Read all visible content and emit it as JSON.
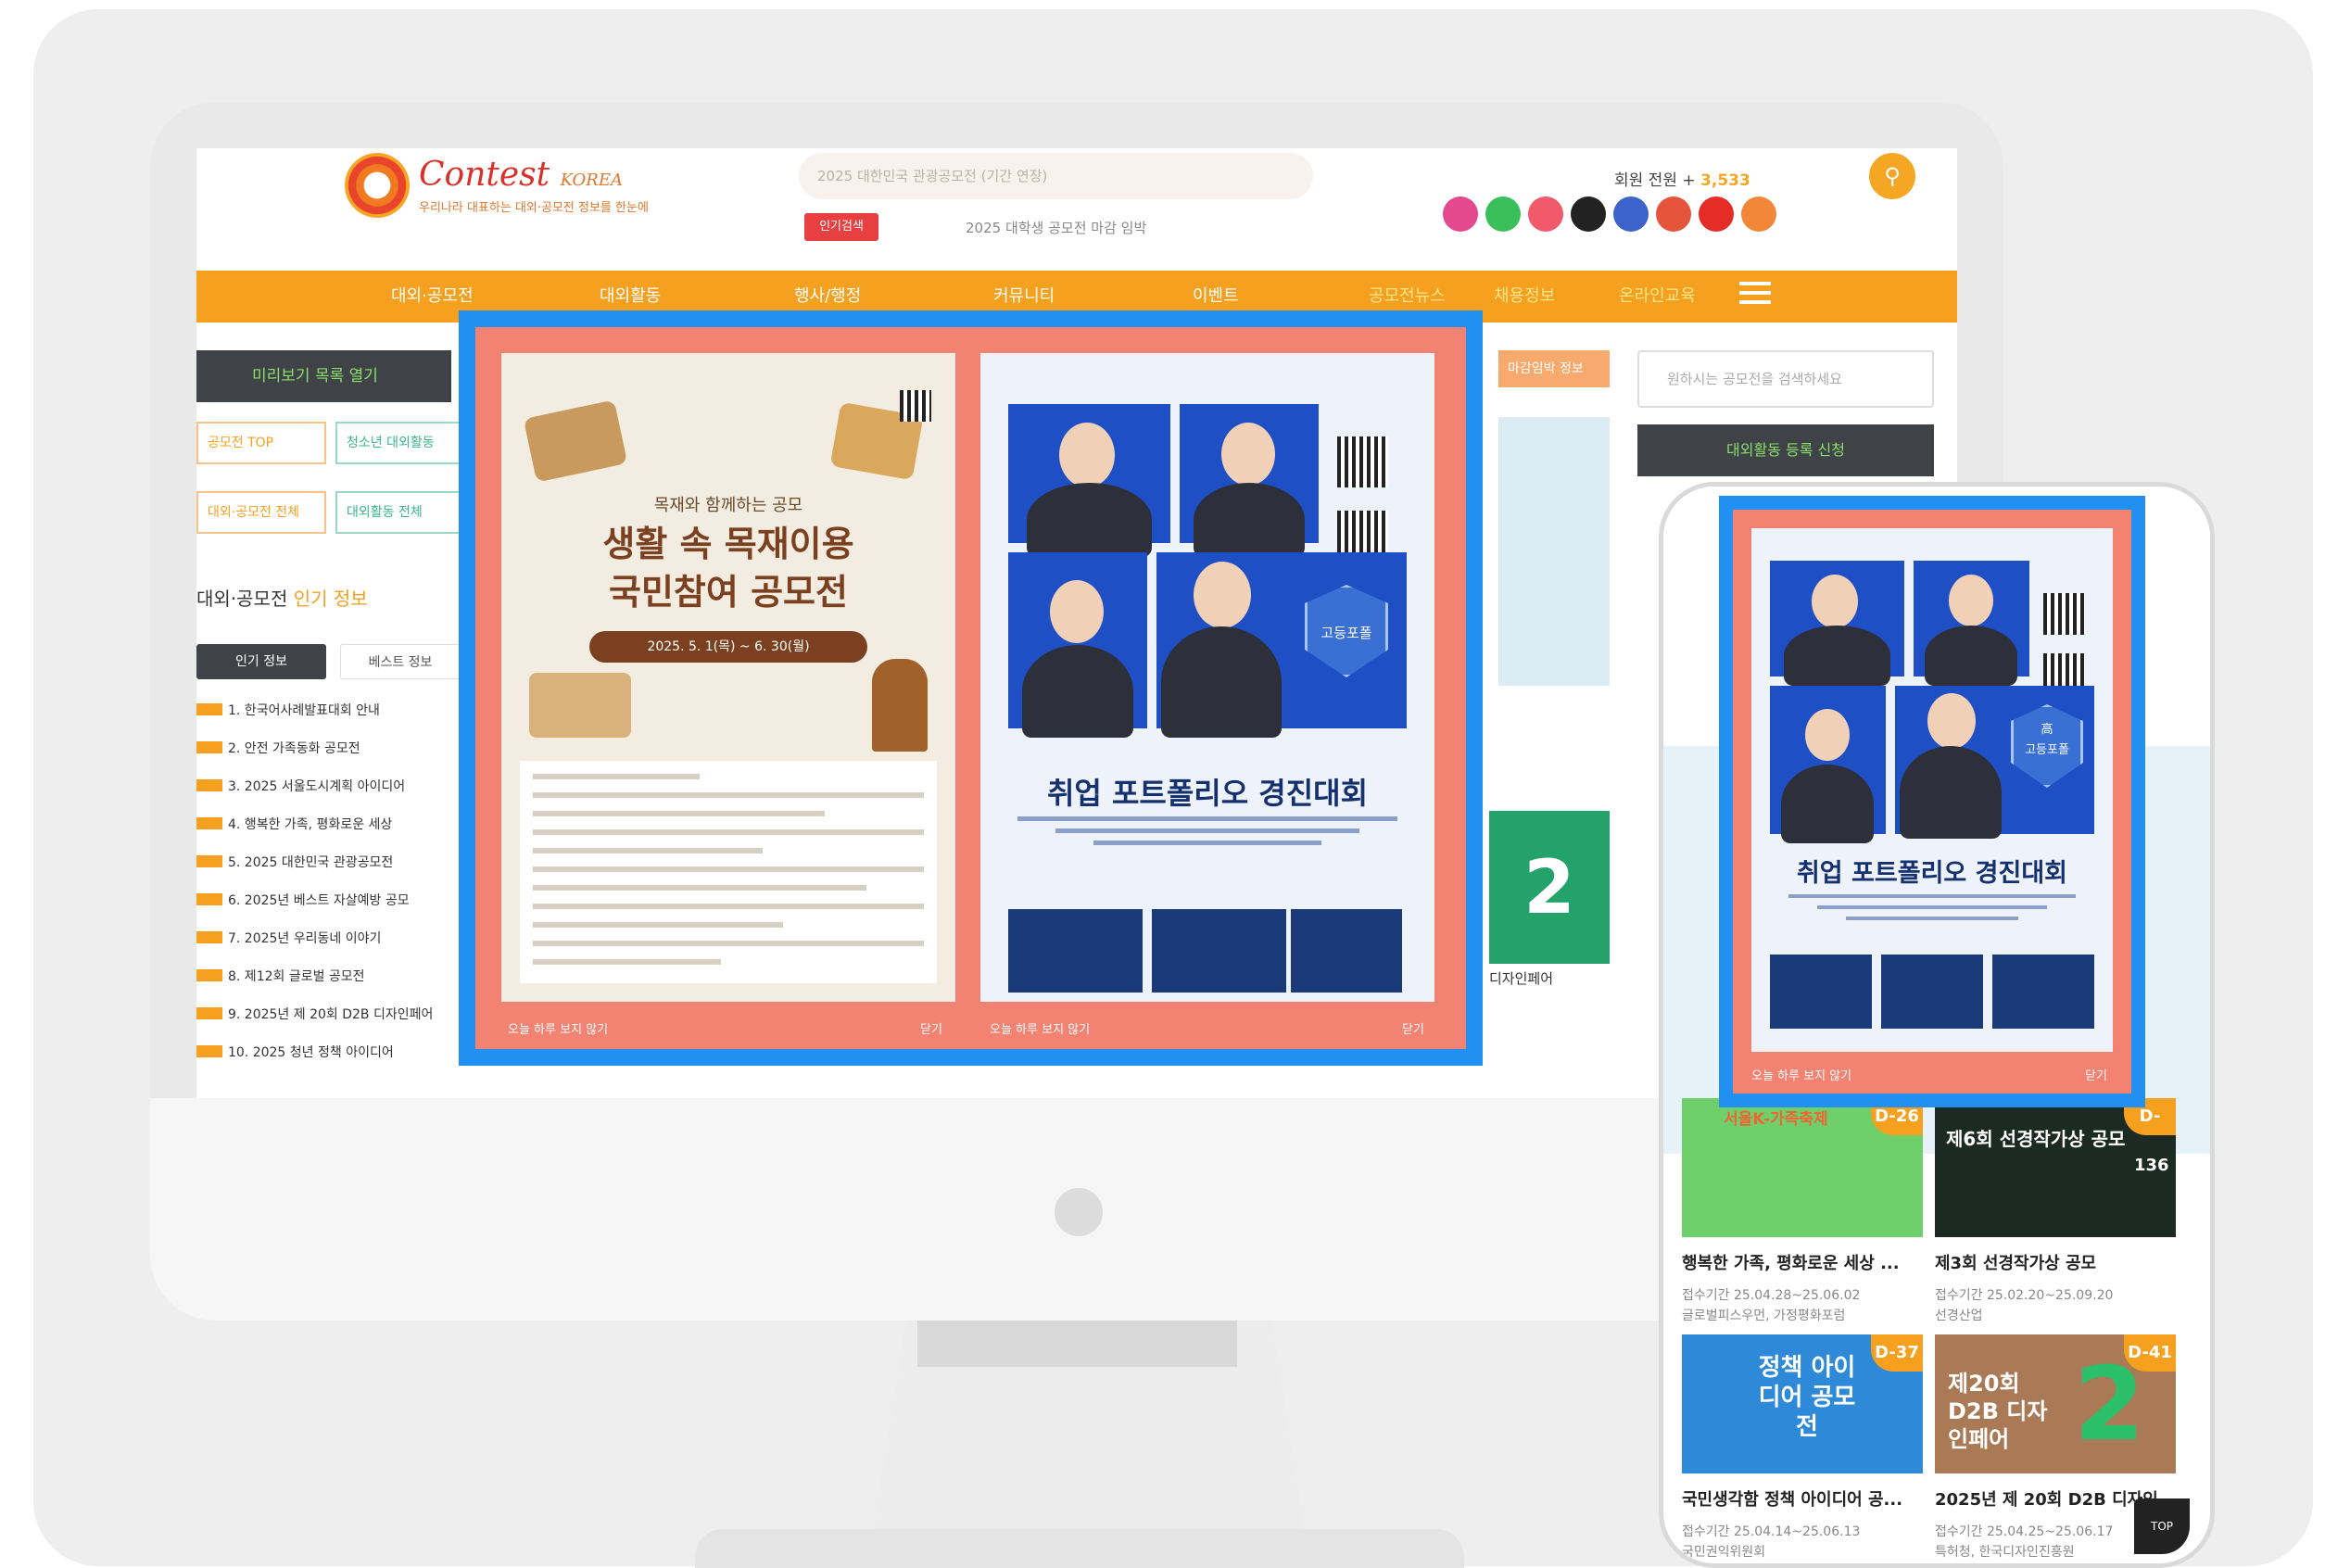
{
  "desktop": {
    "logo_text": "Contest",
    "logo_brand": "KOREA",
    "logo_tagline": "우리나라 대표하는 대외·공모전 정보를 한눈에",
    "search_placeholder": "2025 대한민국 관광공모전 (기간 연장)",
    "hot_badge": "인기검색",
    "ticker_text": "2025 대학생 공모전 마감 임박",
    "stats_label": "회원 전원",
    "stats_value": "3,533",
    "nav": [
      "대외·공모전",
      "대외활동",
      "행사/행정",
      "커뮤니티",
      "이벤트",
      "공모전뉴스",
      "채용정보",
      "온라인교육"
    ],
    "sidebar_button": "미리보기 목록 열기",
    "tags": [
      "공모전 TOP",
      "청소년 대외활동",
      "대외·공모전 전체",
      "대외활동 전체"
    ],
    "section_title": "대외·공모전",
    "section_title_em": "인기 정보",
    "tabs": [
      "인기 정보",
      "베스트 정보"
    ],
    "list": [
      "1. 한국어사례발표대회 안내",
      "2. 안전 가족동화 공모전",
      "3. 2025 서울도시계획 아이디어",
      "4. 행복한 가족, 평화로운 세상",
      "5. 2025 대한민국 관광공모전",
      "6. 2025년 베스트 자살예방 공모",
      "7. 2025년 우리동네 이야기",
      "8. 제12회 글로벌 공모전",
      "9. 2025년 제 20회 D2B 디자인페어",
      "10. 2025 청년 정책 아이디어"
    ],
    "right_search_placeholder": "원하시는 공모전을 검색하세요",
    "right_button": "대외활동 등록 신청",
    "mid_strip": "마감임박 정보",
    "mid_caption": "디자인페어",
    "popup_footer_left": "오늘 하루 보지 않기",
    "popup_footer_right": "닫기",
    "poster_left": {
      "subtitle": "목재와 함께하는 공모",
      "title_line1": "생활 속 목재이용",
      "title_line2": "국민참여 공모전",
      "date": "2025. 5. 1(목) ~ 6. 30(월)"
    },
    "poster_right": {
      "title": "취업 포트폴리오 경진대회",
      "badge": "고등포폴"
    }
  },
  "mobile": {
    "poster_title": "취업 포트폴리오 경진대회",
    "poster_badge_top": "高",
    "poster_badge": "고등포폴",
    "popup_footer_left": "오늘 하루 보지 않기",
    "popup_footer_right": "닫기",
    "cards": [
      {
        "badge": "D-26",
        "title": "행복한 가족, 평화로운 세상 ...",
        "period": "접수기간  25.04.28~25.06.02",
        "host": "글로벌피스우먼, 가정평화포럼",
        "img_text": "서울K-가족축제"
      },
      {
        "badge": "D-",
        "title": "제3회 선경작가상 공모",
        "period": "접수기간  25.02.20~25.09.20",
        "host": "선경산업",
        "img_text": "제6회 선경작가상 공모",
        "img_num": "136"
      },
      {
        "badge": "D-37",
        "title": "국민생각함 정책 아이디어 공...",
        "period": "접수기간  25.04.14~25.06.13",
        "host": "국민권익위원회",
        "img_text": "정책 아이디어 공모전"
      },
      {
        "badge": "D-41",
        "title": "2025년 제 20회 D2B 디자인...",
        "period": "접수기간  25.04.25~25.06.17",
        "host": "특허청, 한국디자인진흥원",
        "img_text": "제20회 D2B 디자인페어"
      }
    ],
    "top_button": "TOP"
  },
  "colors": {
    "accent_orange": "#f5a01f",
    "popup_blue": "#2290f0",
    "popup_salmon": "#f28272",
    "navy": "#15306e"
  }
}
